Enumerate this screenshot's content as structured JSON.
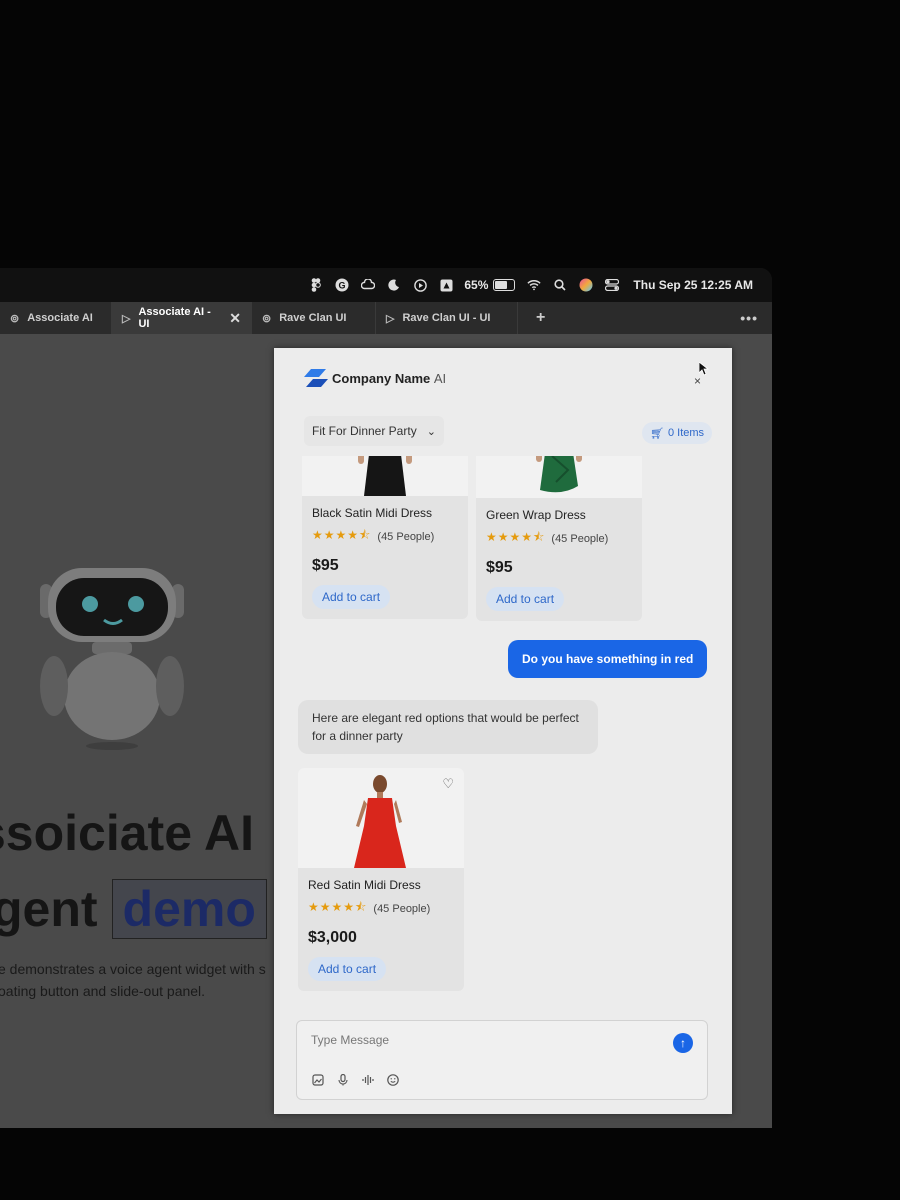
{
  "menubar": {
    "battery_percent": "65%",
    "datetime": "Thu Sep 25  12:25 AM",
    "icons": [
      "figma-icon",
      "grammarly-icon",
      "creative-cloud-icon",
      "moon-icon",
      "play-circle-icon",
      "drive-icon",
      "battery-icon",
      "wifi-icon",
      "search-icon",
      "siri-icon",
      "control-center-icon"
    ]
  },
  "tabs": [
    {
      "label": "Associate AI",
      "icon": "figma-file-icon",
      "active": false
    },
    {
      "label": "Associate AI - UI",
      "icon": "play-icon",
      "active": true
    },
    {
      "label": "Rave Clan UI",
      "icon": "figma-file-icon",
      "active": false
    },
    {
      "label": "Rave Clan UI - UI",
      "icon": "play-icon",
      "active": false
    }
  ],
  "tab_close": "✕",
  "tab_new": "+",
  "page": {
    "headline_line1": "ssoiciate AI",
    "headline_line2_prefix": "gent",
    "headline_line2_highlight": "demo",
    "desc_line1": "e demonstrates a voice agent widget with s",
    "desc_line2": "oating button and slide-out panel."
  },
  "widget": {
    "brand_name": "Company Name",
    "brand_suffix": "AI",
    "close": "×",
    "filter_label": "Fit For Dinner Party",
    "cart_label": "0 Items",
    "products_top": [
      {
        "name": "Black Satin Midi Dress",
        "rating": 4.5,
        "reviews": "(45 People)",
        "price": "$95",
        "button": "Add to cart",
        "color": "#151515"
      },
      {
        "name": "Green Wrap Dress",
        "rating": 4.5,
        "reviews": "(45 People)",
        "price": "$95",
        "button": "Add to cart",
        "color": "#1f6b3d"
      }
    ],
    "user_message": "Do you have something in red",
    "bot_message": "Here are elegant red options that would be perfect for a dinner party",
    "products_red": [
      {
        "name": "Red Satin Midi Dress",
        "rating": 4.5,
        "reviews": "(45 People)",
        "price": "$3,000",
        "button": "Add to cart",
        "color": "#d9261c"
      }
    ],
    "composer_placeholder": "Type Message",
    "composer_tools": [
      "image-upload-icon",
      "microphone-icon",
      "waveform-icon",
      "emoji-icon"
    ]
  },
  "colors": {
    "accent": "#1a66e6",
    "star": "#e59b0e",
    "cart_text": "#2e68c9"
  }
}
